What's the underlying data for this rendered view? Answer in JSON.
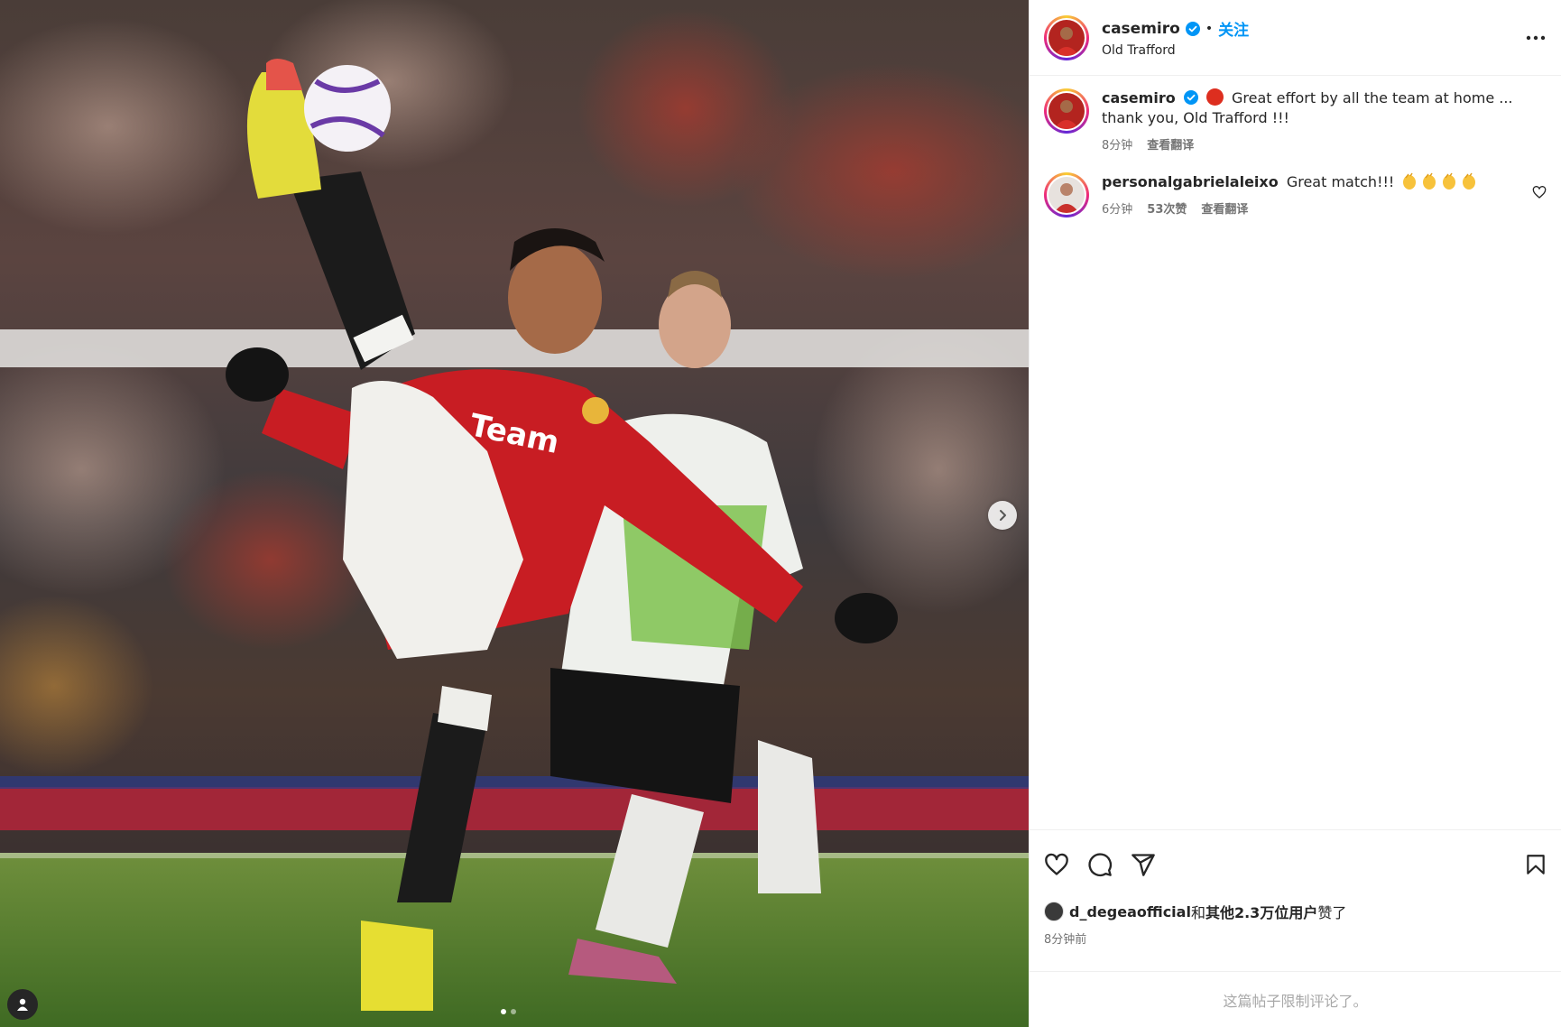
{
  "header": {
    "username": "casemiro",
    "separator": "•",
    "follow_label": "关注",
    "location": "Old Trafford"
  },
  "comments": [
    {
      "username": "casemiro",
      "text": "Great effort by all the team at home ... thank you, Old Trafford !!!",
      "time": "8分钟",
      "translate": "查看翻译"
    },
    {
      "username": "personalgabrielaleixo",
      "text": "Great match!!!",
      "time": "6分钟",
      "likes": "53次赞",
      "translate": "查看翻译"
    }
  ],
  "likes": {
    "first_user": "d_degeaofficial",
    "connector": "和",
    "others": "其他2.3万位用户",
    "suffix": "赞了",
    "time_ago": "8分钟前"
  },
  "restricted_text": "这篇帖子限制评论了。",
  "icons": {
    "verified": "verified-badge-icon",
    "more": "more-options-icon",
    "like": "heart-icon",
    "comment": "comment-bubble-icon",
    "share": "paper-plane-icon",
    "save": "bookmark-icon",
    "next": "chevron-right-icon",
    "tags": "user-tag-icon",
    "clap": "clapping-hands-emoji"
  },
  "colors": {
    "accent": "#0095f6",
    "verified": "#0095f6",
    "muted": "#737373"
  }
}
